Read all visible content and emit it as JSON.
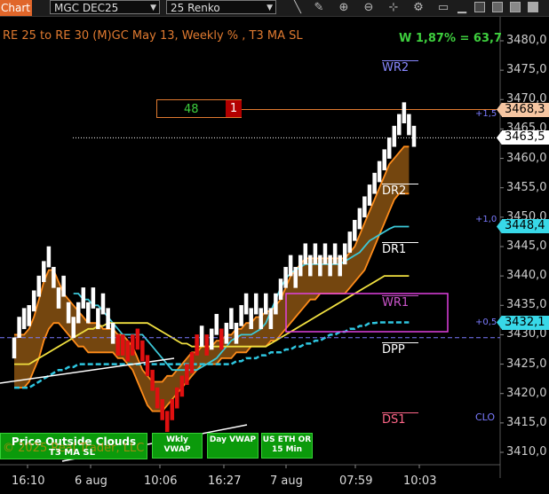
{
  "toolbar": {
    "tab_label": "Chart",
    "instrument": "MGC DEC25",
    "bar_type": "25 Renko",
    "icons": [
      "pencil-icon",
      "zoom-in-icon",
      "zoom-out-icon",
      "crosshair-icon",
      "gear-icon",
      "window-icon"
    ]
  },
  "chart_data": {
    "type": "renko",
    "title": "RE 25 to RE 30 (M)GC May 13, Weekly % , T3 MA SL",
    "annotation_ratio": "W 1,87% = 63,7",
    "ylim": [
      3408,
      3484
    ],
    "y_ticks": [
      "3480,0",
      "3475,0",
      "3470,0",
      "3465,0",
      "3460,0",
      "3455,0",
      "3450,0",
      "3445,0",
      "3440,0",
      "3435,0",
      "3430,0",
      "3425,0",
      "3420,0",
      "3415,0",
      "3410,0"
    ],
    "y_tick_values": [
      3480,
      3475,
      3470,
      3465,
      3460,
      3455,
      3450,
      3445,
      3440,
      3435,
      3430,
      3425,
      3420,
      3415,
      3410
    ],
    "x_ticks": [
      "16:10",
      "6 aug",
      "10:06",
      "16:27",
      "7 aug",
      "07:59",
      "10:03"
    ],
    "bricks": [
      {
        "o": 3426,
        "c": 3429.5,
        "up": true
      },
      {
        "o": 3429.5,
        "c": 3433,
        "up": true
      },
      {
        "o": 3431,
        "c": 3434.5,
        "up": true
      },
      {
        "o": 3431.5,
        "c": 3435,
        "up": true
      },
      {
        "o": 3434,
        "c": 3437.5,
        "up": true
      },
      {
        "o": 3436.5,
        "c": 3440,
        "up": true
      },
      {
        "o": 3439,
        "c": 3442.5,
        "up": true
      },
      {
        "o": 3441.5,
        "c": 3445,
        "up": true
      },
      {
        "o": 3438,
        "c": 3441.5,
        "up": true
      },
      {
        "o": 3434.5,
        "c": 3438,
        "up": true
      },
      {
        "o": 3436.5,
        "c": 3440,
        "up": true
      },
      {
        "o": 3432,
        "c": 3435.5,
        "up": true
      },
      {
        "o": 3429.5,
        "c": 3433,
        "up": true
      },
      {
        "o": 3432,
        "c": 3435.5,
        "up": true
      },
      {
        "o": 3434.5,
        "c": 3438,
        "up": true
      },
      {
        "o": 3432,
        "c": 3435.5,
        "up": true
      },
      {
        "o": 3434.5,
        "c": 3438,
        "up": true
      },
      {
        "o": 3431,
        "c": 3434.5,
        "up": true
      },
      {
        "o": 3433.5,
        "c": 3437,
        "up": true
      },
      {
        "o": 3431,
        "c": 3434.5,
        "up": true
      },
      {
        "o": 3428.5,
        "c": 3432,
        "up": true
      },
      {
        "o": 3430,
        "c": 3426.5,
        "up": false
      },
      {
        "o": 3430,
        "c": 3426.5,
        "up": false
      },
      {
        "o": 3429,
        "c": 3425.5,
        "up": false
      },
      {
        "o": 3430,
        "c": 3426.5,
        "up": false
      },
      {
        "o": 3431,
        "c": 3427.5,
        "up": false
      },
      {
        "o": 3429,
        "c": 3425.5,
        "up": false
      },
      {
        "o": 3426.5,
        "c": 3423,
        "up": false
      },
      {
        "o": 3424,
        "c": 3420.5,
        "up": false
      },
      {
        "o": 3421,
        "c": 3417.5,
        "up": false
      },
      {
        "o": 3419,
        "c": 3415.5,
        "up": false
      },
      {
        "o": 3417,
        "c": 3413.5,
        "up": false
      },
      {
        "o": 3419,
        "c": 3415.5,
        "up": false
      },
      {
        "o": 3421,
        "c": 3417.5,
        "up": false
      },
      {
        "o": 3423,
        "c": 3419.5,
        "up": false
      },
      {
        "o": 3425,
        "c": 3421.5,
        "up": false
      },
      {
        "o": 3427,
        "c": 3423.5,
        "up": false
      },
      {
        "o": 3430,
        "c": 3426.5,
        "up": false
      },
      {
        "o": 3428,
        "c": 3431.5,
        "up": true
      },
      {
        "o": 3430,
        "c": 3426.5,
        "up": false
      },
      {
        "o": 3427.5,
        "c": 3431,
        "up": true
      },
      {
        "o": 3430,
        "c": 3433.5,
        "up": true
      },
      {
        "o": 3431,
        "c": 3427.5,
        "up": false
      },
      {
        "o": 3428.5,
        "c": 3432,
        "up": true
      },
      {
        "o": 3431,
        "c": 3434.5,
        "up": true
      },
      {
        "o": 3428.5,
        "c": 3432,
        "up": true
      },
      {
        "o": 3431.5,
        "c": 3435,
        "up": true
      },
      {
        "o": 3433.5,
        "c": 3437,
        "up": true
      },
      {
        "o": 3431,
        "c": 3434.5,
        "up": true
      },
      {
        "o": 3433.5,
        "c": 3437,
        "up": true
      },
      {
        "o": 3431,
        "c": 3434.5,
        "up": true
      },
      {
        "o": 3433.5,
        "c": 3437,
        "up": true
      },
      {
        "o": 3431,
        "c": 3434.5,
        "up": true
      },
      {
        "o": 3433.5,
        "c": 3437,
        "up": true
      },
      {
        "o": 3436,
        "c": 3439.5,
        "up": true
      },
      {
        "o": 3438,
        "c": 3441.5,
        "up": true
      },
      {
        "o": 3440,
        "c": 3443.5,
        "up": true
      },
      {
        "o": 3438,
        "c": 3441.5,
        "up": true
      },
      {
        "o": 3440,
        "c": 3443.5,
        "up": true
      },
      {
        "o": 3442,
        "c": 3445.5,
        "up": true
      },
      {
        "o": 3440,
        "c": 3443.5,
        "up": true
      },
      {
        "o": 3442,
        "c": 3445.5,
        "up": true
      },
      {
        "o": 3440,
        "c": 3443.5,
        "up": true
      },
      {
        "o": 3442,
        "c": 3445.5,
        "up": true
      },
      {
        "o": 3440,
        "c": 3443.5,
        "up": true
      },
      {
        "o": 3442,
        "c": 3445.5,
        "up": true
      },
      {
        "o": 3440,
        "c": 3443.5,
        "up": true
      },
      {
        "o": 3442,
        "c": 3445.5,
        "up": true
      },
      {
        "o": 3444,
        "c": 3447.5,
        "up": true
      },
      {
        "o": 3446,
        "c": 3449.5,
        "up": true
      },
      {
        "o": 3448,
        "c": 3451.5,
        "up": true
      },
      {
        "o": 3450,
        "c": 3453.5,
        "up": true
      },
      {
        "o": 3452,
        "c": 3455.5,
        "up": true
      },
      {
        "o": 3454,
        "c": 3457.5,
        "up": true
      },
      {
        "o": 3456,
        "c": 3459.5,
        "up": true
      },
      {
        "o": 3458,
        "c": 3461.5,
        "up": true
      },
      {
        "o": 3460,
        "c": 3463.5,
        "up": true
      },
      {
        "o": 3462,
        "c": 3465.5,
        "up": true
      },
      {
        "o": 3464,
        "c": 3467.5,
        "up": true
      },
      {
        "o": 3466,
        "c": 3469.5,
        "up": true
      },
      {
        "o": 3464,
        "c": 3467.5,
        "up": true
      },
      {
        "o": 3462,
        "c": 3465.5,
        "up": true
      }
    ],
    "series": [
      {
        "name": "Cloud Upper",
        "color": "#ff8c1a",
        "values": [
          3430,
          3430,
          3430,
          3431,
          3433,
          3436,
          3439,
          3441,
          3441,
          3439,
          3437,
          3436,
          3435,
          3434,
          3433,
          3432,
          3432,
          3432,
          3431,
          3431,
          3431,
          3430,
          3430,
          3429,
          3428,
          3426,
          3424,
          3423,
          3422,
          3422,
          3422,
          3423,
          3423,
          3424,
          3425,
          3426,
          3427,
          3427,
          3428,
          3428,
          3428,
          3429,
          3429,
          3430,
          3430,
          3431,
          3431,
          3432,
          3432,
          3433,
          3433,
          3434,
          3434,
          3435,
          3436,
          3438,
          3440,
          3441,
          3442,
          3443,
          3443,
          3443,
          3443,
          3443,
          3443,
          3443,
          3443,
          3443,
          3444,
          3445,
          3447,
          3449,
          3451,
          3453,
          3455,
          3457,
          3459,
          3460,
          3461,
          3462,
          3462
        ]
      },
      {
        "name": "Cloud Lower",
        "color": "#ff8c1a",
        "values": [
          3421,
          3421,
          3421,
          3422,
          3424,
          3426,
          3429,
          3431,
          3432,
          3432,
          3431,
          3430,
          3429,
          3428,
          3428,
          3427,
          3427,
          3427,
          3427,
          3427,
          3427,
          3426,
          3426,
          3425,
          3424,
          3422,
          3420,
          3418,
          3417,
          3417,
          3417,
          3418,
          3419,
          3420,
          3421,
          3422,
          3423,
          3424,
          3425,
          3425,
          3425,
          3425,
          3426,
          3426,
          3426,
          3427,
          3427,
          3427,
          3428,
          3428,
          3428,
          3428,
          3429,
          3429,
          3430,
          3431,
          3432,
          3433,
          3434,
          3435,
          3436,
          3436,
          3437,
          3437,
          3437,
          3437,
          3437,
          3437,
          3438,
          3439,
          3440,
          3441,
          3443,
          3445,
          3447,
          3449,
          3451,
          3453,
          3454,
          3454,
          3454
        ]
      },
      {
        "name": "Cyan MA",
        "color": "#3cc8d8",
        "values": [
          null,
          null,
          null,
          null,
          null,
          null,
          null,
          null,
          null,
          null,
          null,
          null,
          3437,
          3437,
          3436,
          3436,
          3435,
          3435,
          3434,
          3433,
          3432,
          3431,
          3430,
          3430,
          3430,
          3430,
          3430,
          3429,
          3428,
          3427,
          3426,
          3425,
          3424,
          3424,
          3424,
          3424,
          3424,
          3424,
          3424.5,
          3425,
          3425.5,
          3426,
          3427,
          3428,
          3429,
          3429.5,
          3430,
          3430,
          3430,
          3430.5,
          3431,
          3432,
          3434,
          3436,
          3438,
          3439.5,
          3440.5,
          3441,
          3441.5,
          3442,
          3442,
          3442,
          3442,
          3442,
          3442,
          3442,
          3442,
          3442.5,
          3443,
          3443.5,
          3444,
          3445,
          3446,
          3446.5,
          3447,
          3447.5,
          3448,
          3448.4,
          3448.4,
          3448.4,
          3448.4
        ]
      },
      {
        "name": "Yellow MA",
        "color": "#f0e040",
        "values": [
          3425,
          3425,
          3425,
          3425,
          3425.5,
          3426,
          3426.5,
          3427,
          3427.5,
          3428,
          3428.5,
          3429,
          3429.5,
          3430,
          3430.5,
          3431,
          3431,
          3431.5,
          3431.5,
          3432,
          3432,
          3432,
          3432,
          3432,
          3432,
          3432,
          3432,
          3432,
          3431.5,
          3431,
          3430.5,
          3430,
          3429.5,
          3429,
          3428.5,
          3428.5,
          3428,
          3428,
          3428,
          3428,
          3428,
          3428,
          3428,
          3428,
          3428,
          3428,
          3428,
          3428,
          3428,
          3428,
          3428,
          3428,
          3428.5,
          3429,
          3429.5,
          3430,
          3430.5,
          3431,
          3431.5,
          3432,
          3432.5,
          3433,
          3433.5,
          3434,
          3434.5,
          3435,
          3435.5,
          3436,
          3436.5,
          3437,
          3437.5,
          3438,
          3438.5,
          3439,
          3439.5,
          3440,
          3440,
          3440,
          3440,
          3440,
          3440
        ]
      },
      {
        "name": "Dashed Cyan MA",
        "color": "#2ec6e0",
        "values": [
          3421,
          3421,
          3421,
          3421,
          3421.5,
          3422,
          3422.5,
          3423,
          3423.5,
          3424,
          3424,
          3424.5,
          3424.5,
          3425,
          3425,
          3425,
          3425,
          3425,
          3425,
          3425,
          3425,
          3425,
          3425,
          3425,
          3425,
          3425,
          3425,
          3425,
          3425,
          3425,
          3425,
          3425,
          3425,
          3425,
          3425,
          3425,
          3425,
          3425,
          3425,
          3425,
          3425,
          3425,
          3425,
          3425,
          3425,
          3425.5,
          3425.5,
          3426,
          3426,
          3426,
          3426.5,
          3426.5,
          3427,
          3427,
          3427,
          3427.5,
          3427.5,
          3428,
          3428,
          3428.5,
          3428.5,
          3429,
          3429,
          3429.5,
          3430,
          3430,
          3430.5,
          3430.5,
          3431,
          3431,
          3431.5,
          3431.5,
          3432,
          3432,
          3432.1,
          3432.1,
          3432.1,
          3432.1,
          3432.1,
          3432.1,
          3432.1
        ]
      }
    ],
    "pivots": [
      {
        "label": "WR2",
        "value": 3476,
        "color": "#8888ff"
      },
      {
        "label": "DR2",
        "value": 3455,
        "color": "#ffffff"
      },
      {
        "label": "DR1",
        "value": 3445,
        "color": "#ffffff"
      },
      {
        "label": "WR1",
        "value": 3436,
        "color": "#cc55cc"
      },
      {
        "label": "DPP",
        "value": 3428,
        "color": "#ffffff"
      },
      {
        "label": "DS1",
        "value": 3416,
        "color": "#ff6688"
      }
    ],
    "level_markers": [
      {
        "label": "+1,5",
        "value": 3467.5
      },
      {
        "label": "+1,0",
        "value": 3449.5
      },
      {
        "label": "+0,5",
        "value": 3432
      },
      {
        "label": "CLO",
        "value": 3416
      }
    ],
    "price_tags": [
      {
        "label": "3468,3",
        "value": 3468.3,
        "bg": "#f6c6a2"
      },
      {
        "label": "3463,5",
        "value": 3463.5,
        "bg": "#ffffff"
      },
      {
        "label": "3448,4",
        "value": 3448.4,
        "bg": "#38d8e8"
      },
      {
        "label": "3432,1",
        "value": 3432.1,
        "bg": "#38d8e8"
      }
    ],
    "dashed_level": 3429.5,
    "dotted_level": 3463.5,
    "counter": {
      "value": "48",
      "red_value": "1"
    }
  },
  "buttons": {
    "price_clouds": "Price Outside Clouds",
    "wkly_vwap": "Wkly\nVWAP",
    "day_vwap": "Day VWAP",
    "us_eth": "US ETH OR\n15 Min",
    "t3_ma_sl": "T3 MA SL"
  },
  "copyright": "© 2025 Real Trader, LLC"
}
